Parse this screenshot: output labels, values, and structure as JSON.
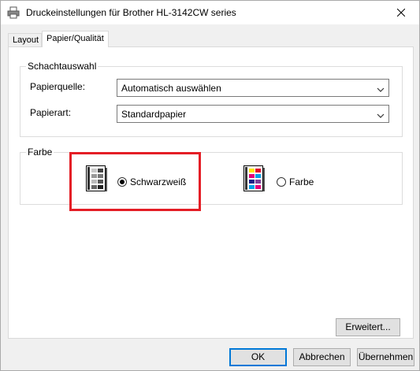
{
  "window": {
    "title": "Druckeinstellungen für Brother HL-3142CW series",
    "icon": "printer-icon",
    "close_icon": "close-icon"
  },
  "tabs": [
    {
      "label": "Layout",
      "active": false
    },
    {
      "label": "Papier/Qualität",
      "active": true
    }
  ],
  "schachtauswahl": {
    "group_label": "Schachtauswahl",
    "papierquelle": {
      "label": "Papierquelle:",
      "value": "Automatisch auswählen"
    },
    "papierart": {
      "label": "Papierart:",
      "value": "Standardpapier"
    }
  },
  "farbe": {
    "group_label": "Farbe",
    "options": [
      {
        "label": "Schwarzweiß",
        "checked": true,
        "icon": "grayscale-page-icon"
      },
      {
        "label": "Farbe",
        "checked": false,
        "icon": "color-page-icon"
      }
    ]
  },
  "buttons": {
    "advanced": "Erweitert...",
    "ok": "OK",
    "cancel": "Abbrechen",
    "apply": "Übernehmen"
  },
  "colors": {
    "highlight": "#e41e26",
    "default_button_border": "#0078d7"
  }
}
